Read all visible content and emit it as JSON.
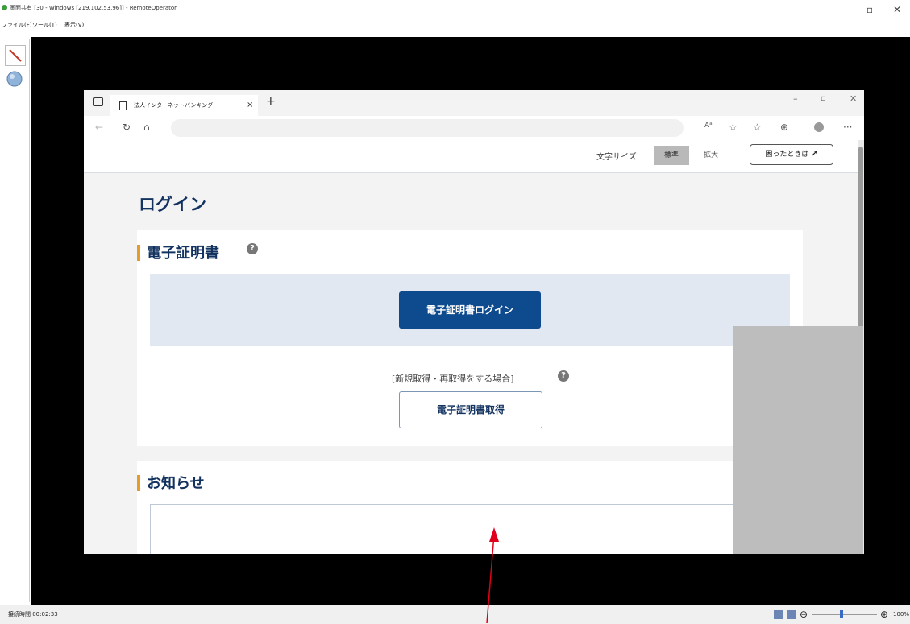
{
  "outer_window": {
    "title": "画面共有 [30 - Windows [219.102.53.96]] - RemoteOperator",
    "menu": [
      "ファイル(F)",
      "ツール(T)",
      "表示(V)"
    ],
    "status_left": "接続時間 00:02:33",
    "zoom_percent": "100%"
  },
  "browser": {
    "tab_title": "法人インターネットバンキング",
    "tab_close": "×",
    "new_tab": "+"
  },
  "page": {
    "font_size_label": "文字サイズ",
    "font_size_standard": "標準",
    "font_size_large": "拡大",
    "help_button": "困ったときは",
    "title": "ログイン",
    "cert_section": {
      "title": "電子証明書",
      "login_button": "電子証明書ログイン",
      "new_label": "[新規取得・再取得をする場合]",
      "get_button": "電子証明書取得"
    },
    "news_section": {
      "title": "お知らせ"
    }
  },
  "colors": {
    "accent_orange": "#e89a2b",
    "primary_blue": "#0e4a8e",
    "heading_navy": "#12325f",
    "annotation_red": "#e0001b"
  }
}
